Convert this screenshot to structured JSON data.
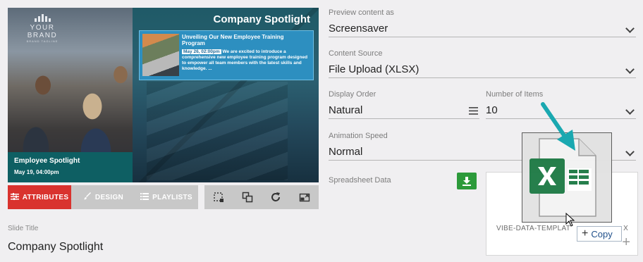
{
  "preview": {
    "brand_name": "YOUR BRAND",
    "brand_tagline": "BRAND TAGLINE",
    "spotlight_title": "Company Spotlight",
    "news_headline": "Unveiling Our New Employee Training Program",
    "news_date": "May 26, 02:00pm",
    "news_body": "We are excited to introduce a comprehensive new employee training program designed to empower all team members with the latest skills and knowledge. ...",
    "employee_title": "Employee Spotlight",
    "employee_date": "May 19, 04:00pm"
  },
  "tabs": [
    {
      "label": "ATTRIBUTES",
      "icon": "sliders-icon",
      "active": true
    },
    {
      "label": "DESIGN",
      "icon": "brush-icon",
      "active": false
    },
    {
      "label": "PLAYLISTS",
      "icon": "list-icon",
      "active": false
    }
  ],
  "tools": [
    "select-region-icon",
    "layers-icon",
    "refresh-icon",
    "resize-icon"
  ],
  "slide": {
    "label": "Slide Title",
    "value": "Company Spotlight"
  },
  "form": {
    "preview_as": {
      "label": "Preview content as",
      "value": "Screensaver"
    },
    "content_source": {
      "label": "Content Source",
      "value": "File Upload (XLSX)"
    },
    "display_order": {
      "label": "Display Order",
      "value": "Natural"
    },
    "number_of_items": {
      "label": "Number of Items",
      "value": "10"
    },
    "animation_speed": {
      "label": "Animation Speed",
      "value": "Normal"
    },
    "spreadsheet": {
      "label": "Spreadsheet Data",
      "file_name": "VIBE-DATA-TEMPLAT",
      "file_name_end": "X"
    }
  },
  "drag": {
    "copy_label": "Copy",
    "icon": "excel-file-icon",
    "cursor": "arrow-cursor-icon"
  },
  "colors": {
    "accent_red": "#d9332e",
    "teal": "#0e5f63",
    "download_green": "#2c9a3a",
    "arrow_teal": "#1aa8b0",
    "excel_green": "#1e7a45"
  }
}
